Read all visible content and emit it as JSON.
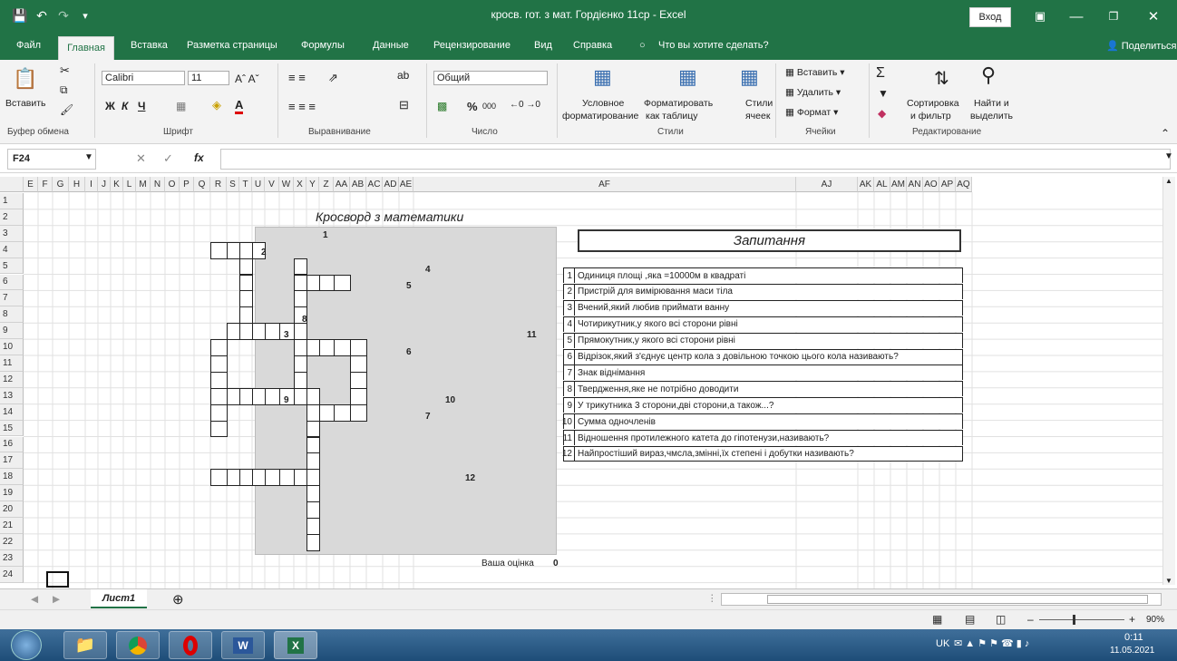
{
  "window": {
    "title": "кросв. гот. з мат. Гордієнко 11ср  -  Excel",
    "login_label": "Вход"
  },
  "menu": {
    "tabs": [
      "Файл",
      "Главная",
      "Вставка",
      "Разметка страницы",
      "Формулы",
      "Данные",
      "Рецензирование",
      "Вид",
      "Справка"
    ],
    "tell_me": "Что вы хотите сделать?",
    "share": "Поделиться"
  },
  "ribbon": {
    "clipboard": {
      "paste": "Вставить",
      "group": "Буфер обмена"
    },
    "font": {
      "name": "Calibri",
      "size": "11",
      "bold": "Ж",
      "italic": "К",
      "underline": "Ч",
      "group": "Шрифт"
    },
    "alignment": {
      "group": "Выравнивание"
    },
    "number": {
      "format": "Общий",
      "percent": "%",
      "thousands": "000",
      "group": "Число"
    },
    "styles": {
      "conditional": "Условное",
      "conditional2": "форматирование",
      "as_table": "Форматировать",
      "as_table2": "как таблицу",
      "cell_styles": "Стили",
      "cell_styles2": "ячеек",
      "group": "Стили"
    },
    "cells": {
      "insert": "Вставить",
      "delete": "Удалить",
      "format": "Формат",
      "group": "Ячейки"
    },
    "editing": {
      "sort": "Сортировка",
      "sort2": "и фильтр",
      "find": "Найти и",
      "find2": "выделить",
      "group": "Редактирование"
    }
  },
  "formula_bar": {
    "name_box": "F24",
    "fx": "fx",
    "value": ""
  },
  "columns": [
    "E",
    "F",
    "G",
    "H",
    "I",
    "J",
    "K",
    "L",
    "M",
    "N",
    "O",
    "P",
    "Q",
    "R",
    "S",
    "T",
    "U",
    "V",
    "W",
    "X",
    "Y",
    "Z",
    "AA",
    "AB",
    "AC",
    "AD",
    "AE",
    "AF",
    "AJ",
    "AK",
    "AL",
    "AM",
    "AN",
    "AO",
    "AP",
    "AQ"
  ],
  "rows": [
    "1",
    "2",
    "3",
    "4",
    "5",
    "6",
    "7",
    "8",
    "9",
    "10",
    "11",
    "12",
    "13",
    "14",
    "15",
    "16",
    "17",
    "18",
    "19",
    "20",
    "21",
    "22",
    "23",
    "24"
  ],
  "crossword": {
    "title": "Кросворд з математики",
    "numbers": [
      "1",
      "2",
      "4",
      "5",
      "8",
      "3",
      "11",
      "6",
      "9",
      "10",
      "7",
      "12"
    ],
    "score_label": "Ваша оцінка",
    "score_value": "0"
  },
  "questions": {
    "header": "Запитання",
    "items": [
      {
        "n": "1",
        "text": "Одиниця площі ,яка =10000м в квадраті"
      },
      {
        "n": "2",
        "text": "Пристрій для вимірювання маси тіла"
      },
      {
        "n": "3",
        "text": "Вчений,який любив приймати ванну"
      },
      {
        "n": "4",
        "text": "Чотирикутник,у якого всі сторони рівні"
      },
      {
        "n": "5",
        "text": "Прямокутник,у якого всі сторони рівні"
      },
      {
        "n": "6",
        "text": "Відрізок,який з'єднує центр кола з довільною точкою цього кола називають?"
      },
      {
        "n": "7",
        "text": "Знак віднімання"
      },
      {
        "n": "8",
        "text": "Твердження,яке не потрібно доводити"
      },
      {
        "n": "9",
        "text": "У трикутника 3 сторони,дві сторони,а також...?"
      },
      {
        "n": "10",
        "text": "Сумма одночленів"
      },
      {
        "n": "11",
        "text": "Відношення протилежного катета до гіпотенузи,називають?"
      },
      {
        "n": "12",
        "text": "Найпростіший вираз,чмсла,змінні,їх степені і добутки називають?"
      }
    ]
  },
  "sheet_tabs": {
    "active": "Лист1"
  },
  "status": {
    "zoom": "90%"
  },
  "taskbar": {
    "lang": "UK",
    "time": "0:11",
    "date": "11.05.2021"
  },
  "colors": {
    "excel_green": "#217346",
    "crossword_bg": "#d9d9d9"
  }
}
